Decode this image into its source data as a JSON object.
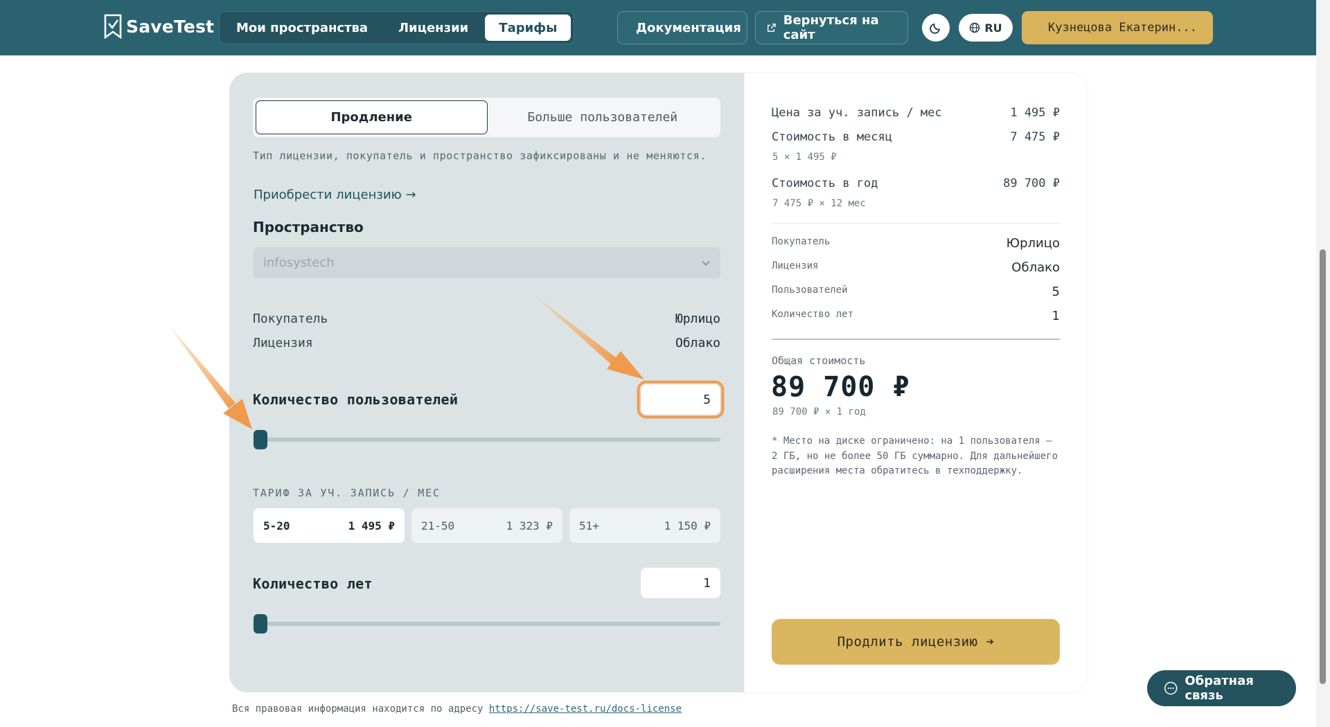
{
  "header": {
    "logo_text": "SaveTest",
    "nav": [
      "Мои пространства",
      "Лицензии",
      "Тарифы"
    ],
    "nav_active": "Тарифы",
    "docs_label": "Документация",
    "back_label": "Вернуться на сайт",
    "lang_label": "RU",
    "user_label": "Кузнецова Екатерин..."
  },
  "form": {
    "tabs": [
      "Продление",
      "Больше пользователей"
    ],
    "active_tab": "Продление",
    "note": "Тип лицензии, покупатель и пространство зафиксированы и не меняются.",
    "buy_link": "Приобрести лицензию →",
    "space_label": "Пространство",
    "space_value": "infosystech",
    "buyer_label": "Покупатель",
    "buyer_value": "Юрлицо",
    "license_label": "Лицензия",
    "license_value": "Облако",
    "users_label": "Количество пользователей",
    "users_value": "5",
    "users_slider_fraction": 0,
    "tariff_heading": "ТАРИФ ЗА УЧ. ЗАПИСЬ / МЕС",
    "tariffs": [
      {
        "range": "5-20",
        "price": "1 495 ₽",
        "active": true
      },
      {
        "range": "21-50",
        "price": "1 323 ₽",
        "active": false
      },
      {
        "range": "51+",
        "price": "1 150 ₽",
        "active": false
      }
    ],
    "years_label": "Количество лет",
    "years_value": "1",
    "years_slider_fraction": 0
  },
  "summary": {
    "price_per_label": "Цена за уч. запись / мес",
    "price_per_value": "1 495 ₽",
    "month_label": "Стоимость в месяц",
    "month_value": "7 475 ₽",
    "month_sub": "5 × 1 495 ₽",
    "year_label": "Стоимость в год",
    "year_value": "89 700 ₽",
    "year_sub": "7 475 ₽ × 12 мес",
    "buyer_label": "Покупатель",
    "buyer_value": "Юрлицо",
    "license_label": "Лицензия",
    "license_value": "Облако",
    "users_label": "Пользователей",
    "users_value": "5",
    "years_label": "Количество лет",
    "years_value": "1",
    "total_label": "Общая стоимость",
    "total_value": "89 700 ₽",
    "total_sub": "89 700 ₽ × 1 год",
    "disk_note": "* Место на диске ограничено: на 1 пользователя – 2 ГБ, но не более 50 ГБ суммарно. Для дальнейшего расширения места обратитесь в техподдержку.",
    "cta_label": "Продлить лицензию ➔"
  },
  "footer": {
    "legal_text": "Вся правовая информация находится по адресу ",
    "legal_link": "https://save-test.ru/docs-license"
  },
  "feedback_label": "Обратная связь",
  "colors": {
    "header_bg": "#2b6270",
    "accent_gold": "#dbb660",
    "annotation_orange": "#ef9a4c"
  }
}
